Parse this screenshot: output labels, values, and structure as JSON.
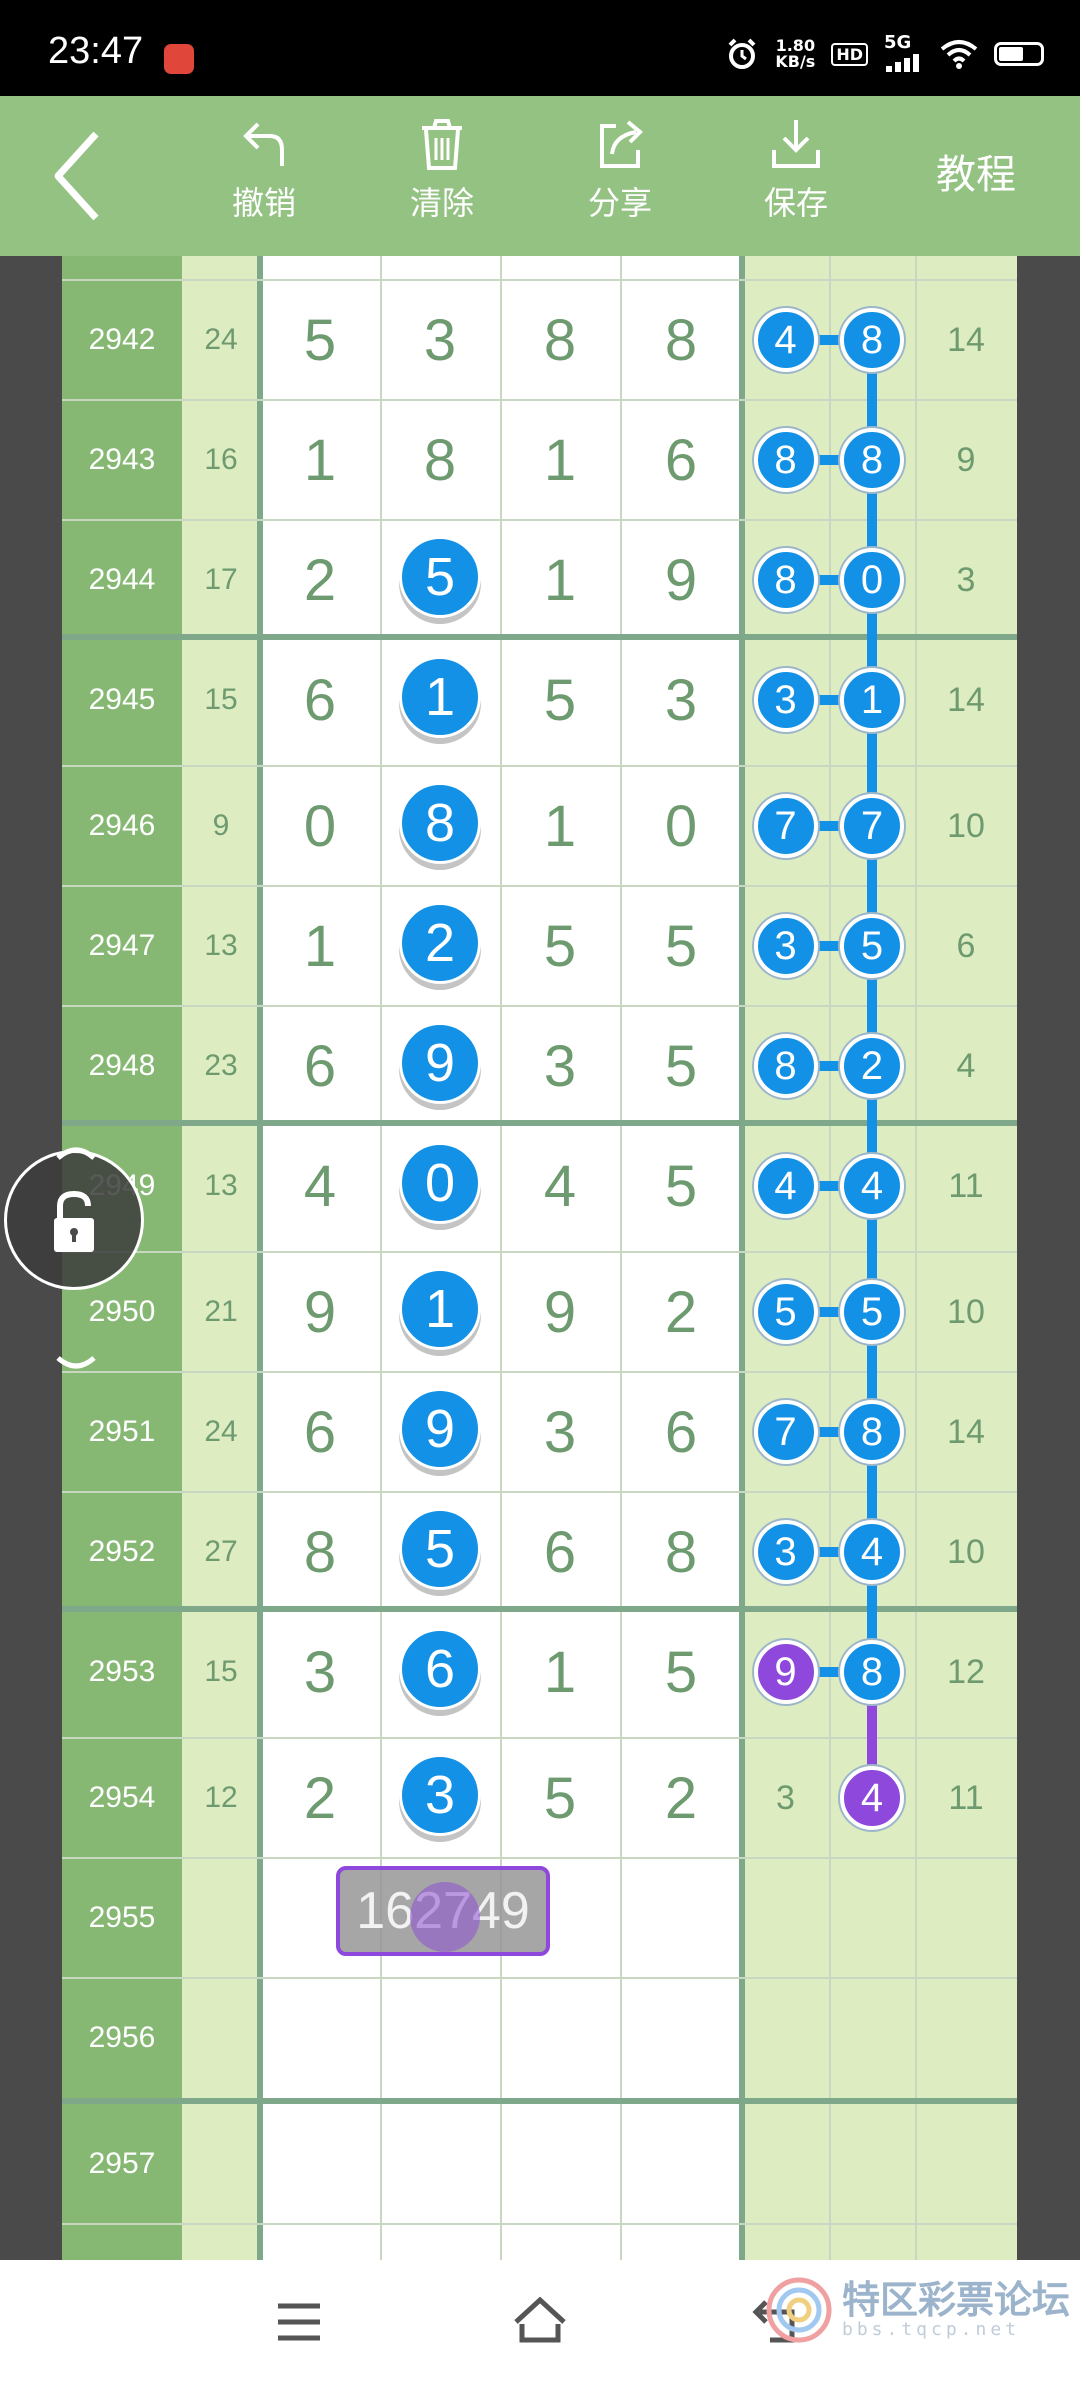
{
  "status_bar": {
    "time": "23:47",
    "net_speed_value": "1.80",
    "net_speed_unit": "KB/s",
    "hd": "HD",
    "network": "5G"
  },
  "toolbar": {
    "undo": "撤销",
    "clear": "清除",
    "share": "分享",
    "save": "保存",
    "tutorial": "教程"
  },
  "rows": [
    {
      "issue": "2942",
      "sum": "24",
      "digits": [
        "5",
        "3",
        "8",
        "8"
      ],
      "pair": [
        "4",
        "8"
      ],
      "span": "14"
    },
    {
      "issue": "2943",
      "sum": "16",
      "digits": [
        "1",
        "8",
        "1",
        "6"
      ],
      "pair": [
        "8",
        "8"
      ],
      "span": "9"
    },
    {
      "issue": "2944",
      "sum": "17",
      "digits": [
        "2",
        "5",
        "1",
        "9"
      ],
      "pair": [
        "8",
        "0"
      ],
      "span": "3"
    },
    {
      "issue": "2945",
      "sum": "15",
      "digits": [
        "6",
        "1",
        "5",
        "3"
      ],
      "pair": [
        "3",
        "1"
      ],
      "span": "14"
    },
    {
      "issue": "2946",
      "sum": "9",
      "digits": [
        "0",
        "8",
        "1",
        "0"
      ],
      "pair": [
        "7",
        "7"
      ],
      "span": "10"
    },
    {
      "issue": "2947",
      "sum": "13",
      "digits": [
        "1",
        "2",
        "5",
        "5"
      ],
      "pair": [
        "3",
        "5"
      ],
      "span": "6"
    },
    {
      "issue": "2948",
      "sum": "23",
      "digits": [
        "6",
        "9",
        "3",
        "5"
      ],
      "pair": [
        "8",
        "2"
      ],
      "span": "4"
    },
    {
      "issue": "2949",
      "sum": "13",
      "digits": [
        "4",
        "0",
        "4",
        "5"
      ],
      "pair": [
        "4",
        "4"
      ],
      "span": "11"
    },
    {
      "issue": "2950",
      "sum": "21",
      "digits": [
        "9",
        "1",
        "9",
        "2"
      ],
      "pair": [
        "5",
        "5"
      ],
      "span": "10"
    },
    {
      "issue": "2951",
      "sum": "24",
      "digits": [
        "6",
        "9",
        "3",
        "6"
      ],
      "pair": [
        "7",
        "8"
      ],
      "span": "14"
    },
    {
      "issue": "2952",
      "sum": "27",
      "digits": [
        "8",
        "5",
        "6",
        "8"
      ],
      "pair": [
        "3",
        "4"
      ],
      "span": "10"
    },
    {
      "issue": "2953",
      "sum": "15",
      "digits": [
        "3",
        "6",
        "1",
        "5"
      ],
      "pair": [
        "9",
        "8"
      ],
      "span": "12"
    },
    {
      "issue": "2954",
      "sum": "12",
      "digits": [
        "2",
        "3",
        "5",
        "2"
      ],
      "pair": [
        "3",
        "4"
      ],
      "span": "11"
    },
    {
      "issue": "2955",
      "sum": "",
      "digits": [
        "",
        "",
        "",
        ""
      ],
      "pair": [
        "",
        ""
      ],
      "span": ""
    },
    {
      "issue": "2956",
      "sum": "",
      "digits": [
        "",
        "",
        "",
        ""
      ],
      "pair": [
        "",
        ""
      ],
      "span": ""
    },
    {
      "issue": "2957",
      "sum": "",
      "digits": [
        "",
        "",
        "",
        ""
      ],
      "pair": [
        "",
        ""
      ],
      "span": ""
    }
  ],
  "highlights": {
    "digit_ball_column": 1,
    "digit_ball_rows": [
      2,
      3,
      4,
      5,
      6,
      7,
      8,
      9,
      10,
      11,
      12
    ],
    "pair_ball_rows": [
      0,
      1,
      2,
      3,
      4,
      5,
      6,
      7,
      8,
      9,
      10,
      11
    ],
    "purple_pair_left_row": 11,
    "last_ball_row": 12,
    "colors": {
      "blue": "#1291e6",
      "purple": "#8f48dc",
      "header_green": "#94c283",
      "issue_green": "#86b874",
      "light_green": "#deecc1",
      "digit_text": "#6e9a70"
    }
  },
  "input_overlay": {
    "value": "162749"
  },
  "icons": {
    "back": "chevron-left-icon",
    "undo": "undo-arrow-icon",
    "clear": "trash-icon",
    "share": "share-icon",
    "save": "download-icon",
    "lock": "lock-icon",
    "nav_menu": "menu-icon",
    "nav_home": "home-icon",
    "nav_back": "back-icon"
  },
  "watermark": {
    "text": "特区彩票论坛",
    "url": "bbs.tqcp.net"
  }
}
